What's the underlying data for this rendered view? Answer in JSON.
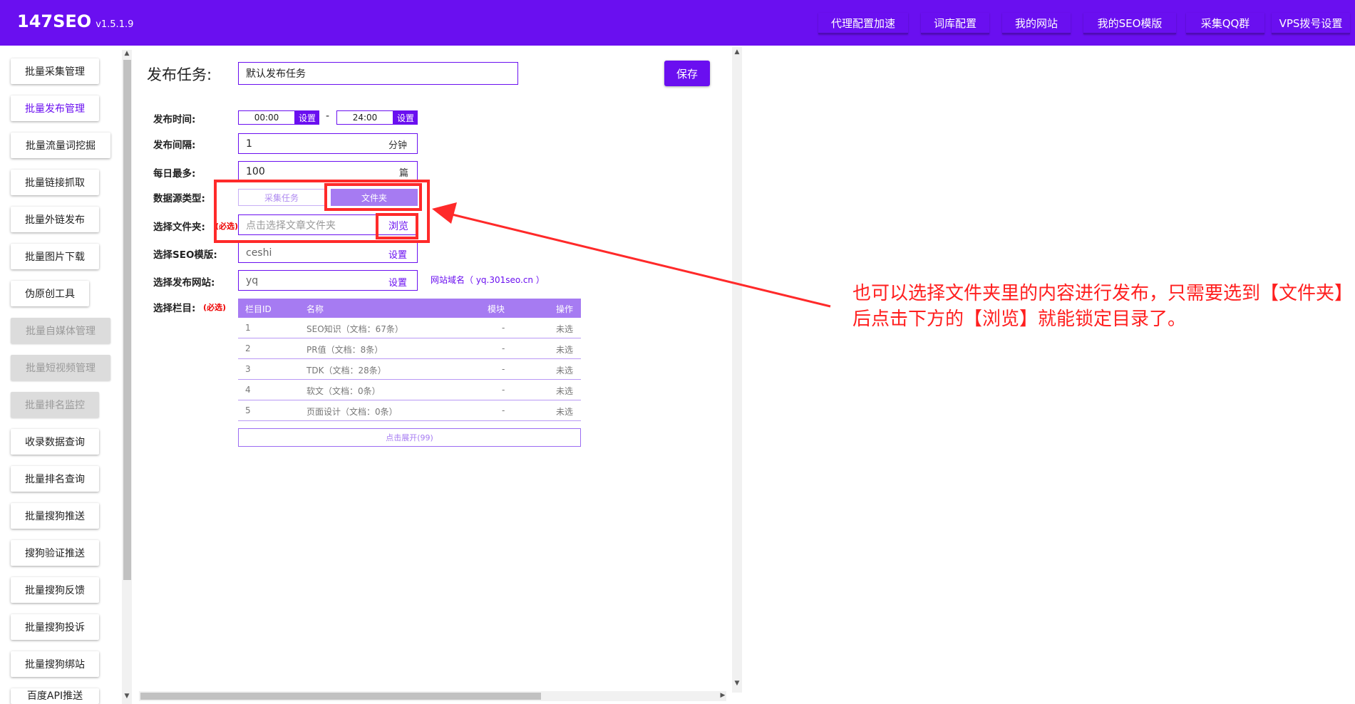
{
  "app": {
    "name": "147SEO",
    "version": "v1.5.1.9"
  },
  "nav": [
    {
      "label": "代理配置加速"
    },
    {
      "label": "词库配置"
    },
    {
      "label": "我的网站"
    },
    {
      "label": "我的SEO模版"
    },
    {
      "label": "采集QQ群"
    },
    {
      "label": "VPS拨号设置"
    }
  ],
  "sidebar": {
    "items": [
      {
        "label": "批量采集管理",
        "state": "normal"
      },
      {
        "label": "批量发布管理",
        "state": "active"
      },
      {
        "label": "批量流量词挖掘",
        "state": "normal"
      },
      {
        "label": "批量链接抓取",
        "state": "normal"
      },
      {
        "label": "批量外链发布",
        "state": "normal"
      },
      {
        "label": "批量图片下载",
        "state": "normal"
      },
      {
        "label": "伪原创工具",
        "state": "normal"
      },
      {
        "label": "批量自媒体管理",
        "state": "disabled"
      },
      {
        "label": "批量短视频管理",
        "state": "disabled"
      },
      {
        "label": "批量排名监控",
        "state": "disabled"
      },
      {
        "label": "收录数据查询",
        "state": "normal"
      },
      {
        "label": "批量排名查询",
        "state": "normal"
      },
      {
        "label": "批量搜狗推送",
        "state": "normal"
      },
      {
        "label": "搜狗验证推送",
        "state": "normal"
      },
      {
        "label": "批量搜狗反馈",
        "state": "normal"
      },
      {
        "label": "批量搜狗投诉",
        "state": "normal"
      },
      {
        "label": "批量搜狗绑站",
        "state": "normal"
      },
      {
        "label": "百度API推送",
        "state": "normal"
      }
    ]
  },
  "form": {
    "task_label": "发布任务:",
    "task_value": "默认发布任务",
    "save_label": "保存",
    "time_label": "发布时间:",
    "time_start": "00:00",
    "time_end": "24:00",
    "time_set": "设置",
    "time_sep": "-",
    "interval_label": "发布间隔:",
    "interval_value": "1",
    "interval_unit": "分钟",
    "daily_label": "每日最多:",
    "daily_value": "100",
    "daily_unit": "篇",
    "source_label": "数据源类型:",
    "source_options": [
      "采集任务",
      "文件夹"
    ],
    "source_selected": "文件夹",
    "folder_label": "选择文件夹:",
    "required": "(必选)",
    "folder_placeholder": "点击选择文章文件夹",
    "browse_label": "浏览",
    "seo_label": "选择SEO模版:",
    "seo_value": "ceshi",
    "set_label": "设置",
    "site_label": "选择发布网站:",
    "site_value": "yq",
    "site_domain": "网站域名（ yq.301seo.cn ）",
    "column_label": "选择栏目:",
    "column_required": "(必选)"
  },
  "table": {
    "headers": [
      "栏目ID",
      "名称",
      "模块",
      "操作"
    ],
    "rows": [
      {
        "id": "1",
        "name": "SEO知识（文档：67条）",
        "module": "-",
        "op": "未选"
      },
      {
        "id": "2",
        "name": "PR值（文档：8条）",
        "module": "-",
        "op": "未选"
      },
      {
        "id": "3",
        "name": "TDK（文档：28条）",
        "module": "-",
        "op": "未选"
      },
      {
        "id": "4",
        "name": "软文（文档：0条）",
        "module": "-",
        "op": "未选"
      },
      {
        "id": "5",
        "name": "页面设计（文档：0条）",
        "module": "-",
        "op": "未选"
      }
    ],
    "expand_label": "点击展开(99)"
  },
  "annotation": {
    "text": "也可以选择文件夹里的内容进行发布，只需要选到【文件夹】后点击下方的【浏览】就能锁定目录了。"
  },
  "colors": {
    "brand": "#6a0ff0",
    "table_header": "#a67bf2",
    "annotation": "#ff1f1f"
  }
}
